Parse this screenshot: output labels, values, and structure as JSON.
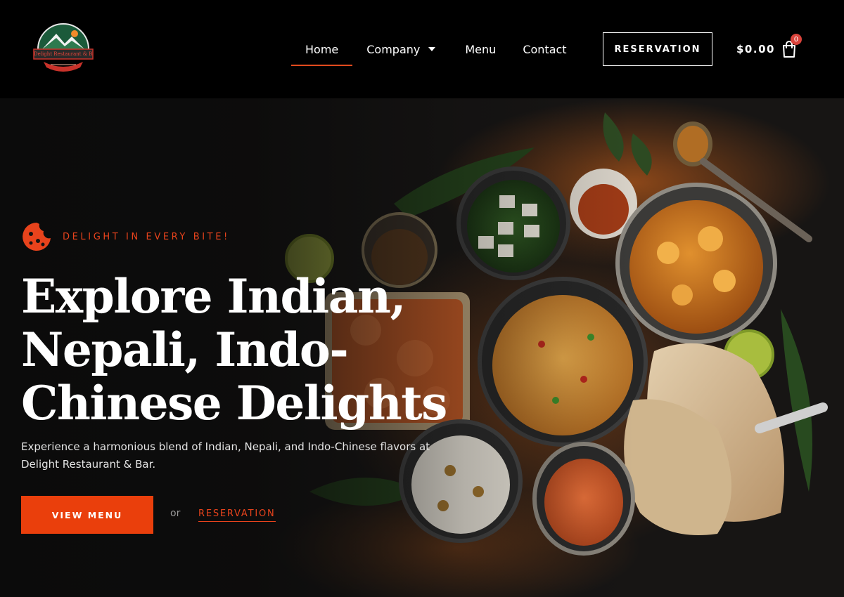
{
  "brand": {
    "logo_icon": "restaurant-logo",
    "logo_text": "Delight Restaurant & Bar"
  },
  "nav": {
    "items": [
      {
        "label": "Home",
        "active": true
      },
      {
        "label": "Company",
        "has_dropdown": true
      },
      {
        "label": "Menu"
      },
      {
        "label": "Contact"
      }
    ],
    "reservation_button": "RESERVATION"
  },
  "cart": {
    "total": "$0.00",
    "count": "0",
    "icon": "shopping-bag-icon"
  },
  "hero": {
    "tagline_icon": "cookie-icon",
    "tagline": "DELIGHT IN EVERY BITE!",
    "headline_lines": [
      "Explore Indian,",
      "Nepali, Indo-",
      "Chinese Delights"
    ],
    "description_lines": [
      "Experience a harmonious blend of Indian, Nepali, and Indo-Chinese flavors at",
      "Delight Restaurant & Bar."
    ],
    "primary_button": "VIEW MENU",
    "or_text": "or",
    "secondary_link": "RESERVATION"
  },
  "colors": {
    "accent": "#ea3f0c",
    "background": "#000000",
    "text": "#ffffff",
    "badge": "#d9433b"
  }
}
